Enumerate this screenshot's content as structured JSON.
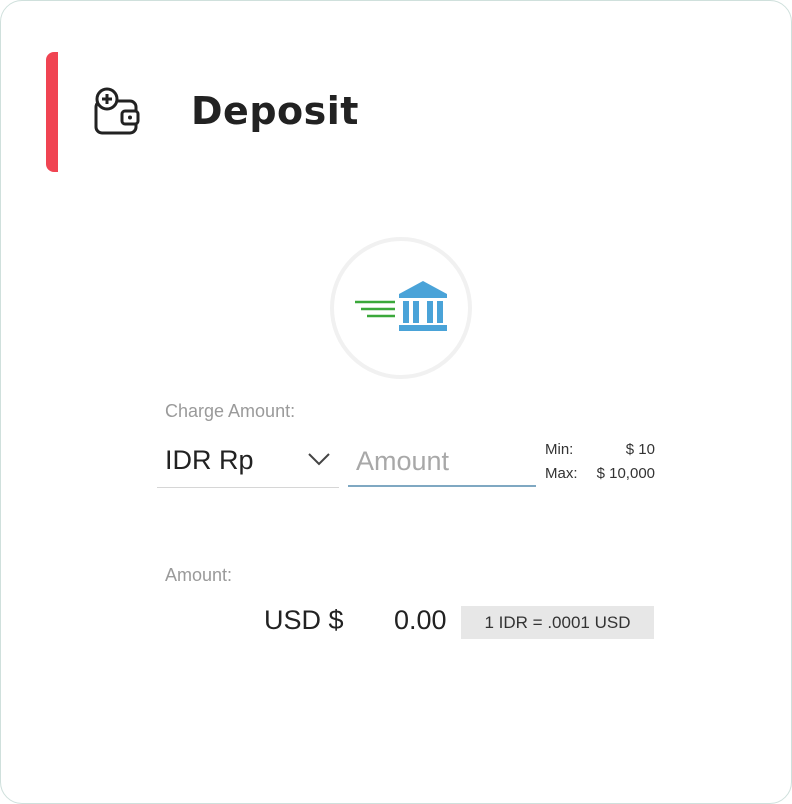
{
  "header": {
    "title": "Deposit",
    "icon": "wallet-add-icon",
    "accent_color": "#f04452"
  },
  "method": {
    "icon": "bank-icon",
    "icon_color": "#4aa3d8",
    "speed_lines_color": "#3aa83a"
  },
  "charge": {
    "label": "Charge Amount:",
    "currency": "IDR Rp",
    "amount_placeholder": "Amount",
    "amount_value": "",
    "min_label": "Min:",
    "min_value": "$ 10",
    "max_label": "Max:",
    "max_value": "$ 10,000"
  },
  "conversion": {
    "label": "Amount:",
    "currency": "USD $",
    "value": "0.00",
    "rate": "1 IDR = .0001 USD"
  }
}
